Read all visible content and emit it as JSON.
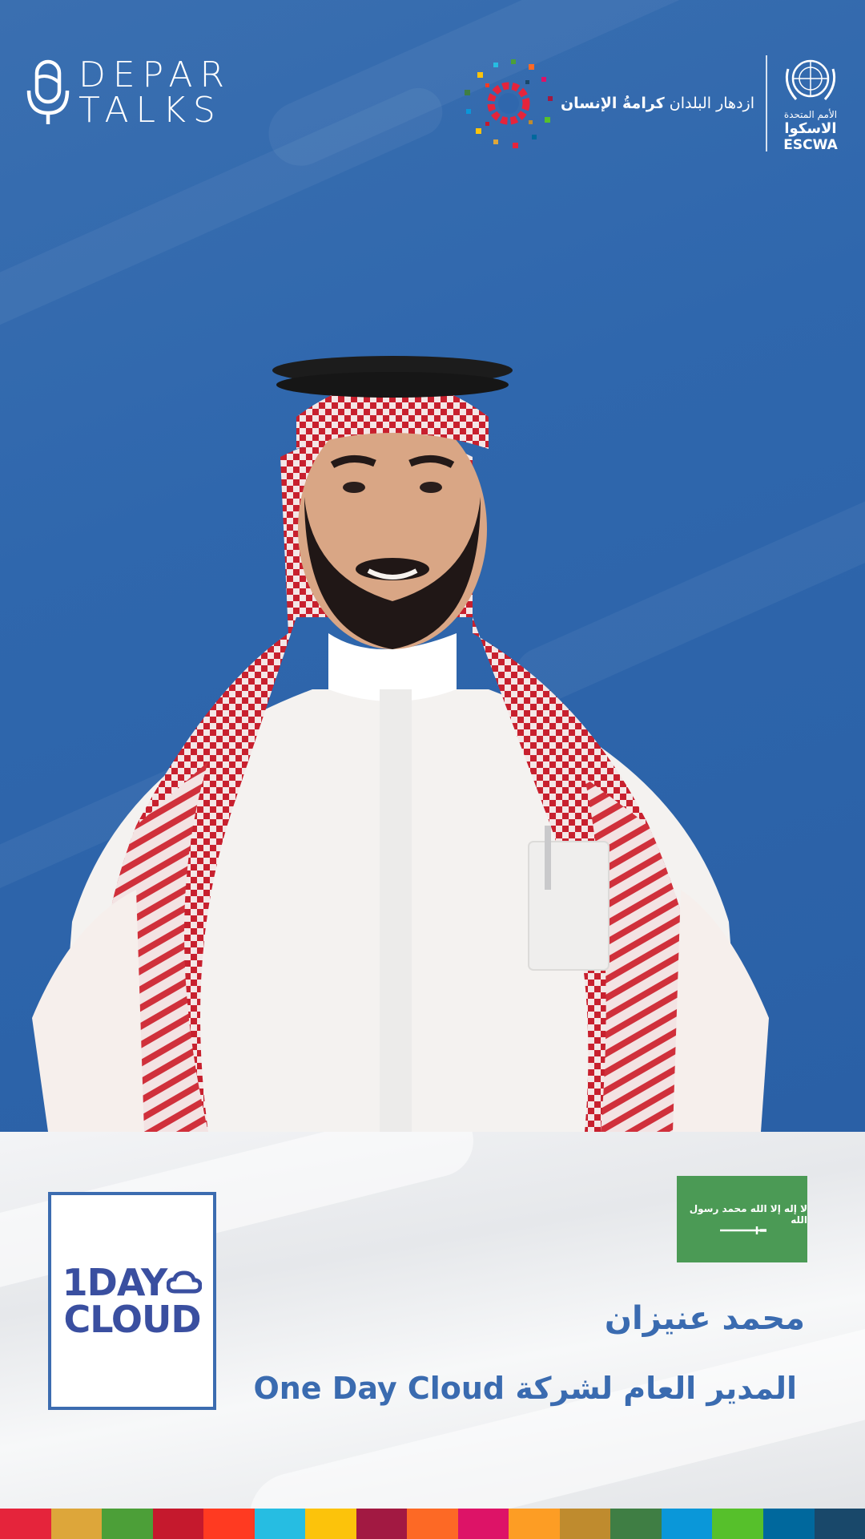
{
  "brand": {
    "line1": "DEPAR",
    "line2": "TALKS"
  },
  "partners": {
    "slogan_regular": "ازدهار البلدان",
    "slogan_bold": "كرامةُ الإنسان",
    "un_arabic_small": "الأمم المتحدة",
    "un_arabic": "الاسكوا",
    "un_english": "ESCWA"
  },
  "company_logo": {
    "line1": "1DAY",
    "line2": "CLOUD"
  },
  "flag": {
    "inscription": "لا إله إلا الله محمد رسول الله"
  },
  "speaker": {
    "name": "محمد عنيزان",
    "title": "المدير العام لشركة One Day Cloud"
  },
  "colors": {
    "background_blue": "#2f67ad",
    "text_blue": "#3a6bb0",
    "flag_green": "#4b9a55",
    "sdg_stripe": [
      "#e5243b",
      "#dda63a",
      "#4c9f38",
      "#c5192d",
      "#ff3a21",
      "#26bde2",
      "#fcc30b",
      "#a21942",
      "#fd6925",
      "#dd1367",
      "#fd9d24",
      "#bf8b2e",
      "#3f7e44",
      "#0a97d9",
      "#56c02b",
      "#00689d",
      "#19486a"
    ]
  }
}
